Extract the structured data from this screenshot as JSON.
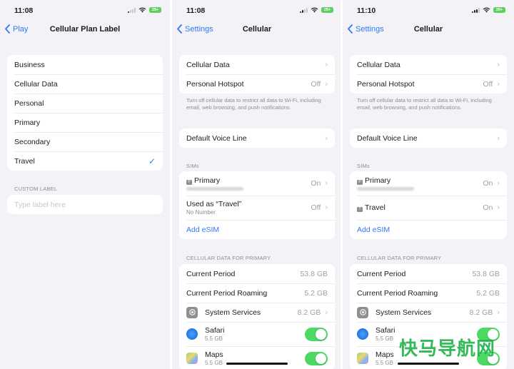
{
  "screens": [
    {
      "status": {
        "time": "11:08",
        "battery": "29+"
      },
      "nav": {
        "back": "Play",
        "title": "Cellular Plan Label"
      },
      "labels": [
        {
          "label": "Business",
          "selected": false
        },
        {
          "label": "Cellular Data",
          "selected": false
        },
        {
          "label": "Personal",
          "selected": false
        },
        {
          "label": "Primary",
          "selected": false
        },
        {
          "label": "Secondary",
          "selected": false
        },
        {
          "label": "Travel",
          "selected": true
        }
      ],
      "checkmark": "✓",
      "custom_label_header": "CUSTOM LABEL",
      "custom_label_placeholder": "Type label here"
    },
    {
      "status": {
        "time": "11:08",
        "battery": "29+"
      },
      "nav": {
        "back": "Settings",
        "title": "Cellular"
      },
      "top_group": [
        {
          "label": "Cellular Data",
          "value": ""
        },
        {
          "label": "Personal Hotspot",
          "value": "Off"
        }
      ],
      "footer": "Turn off cellular data to restrict all data to Wi-Fi, including email, web browsing, and push notifications.",
      "voice_line": "Default Voice Line",
      "sims_header": "SIMs",
      "sims": [
        {
          "badge": "P",
          "label": "Primary",
          "sub": "(redacted number)",
          "value": "On"
        },
        {
          "badge": "",
          "label": "Used as “Travel”",
          "sub": "No Number",
          "value": "Off"
        }
      ],
      "add_esim": "Add eSIM",
      "data_header": "CELLULAR DATA FOR PRIMARY",
      "data_rows": [
        {
          "label": "Current Period",
          "value": "53.8 GB"
        },
        {
          "label": "Current Period Roaming",
          "value": "5.2 GB"
        }
      ],
      "apps": [
        {
          "icon": "gear-icon",
          "label": "System Services",
          "value": "8.2 GB"
        },
        {
          "icon": "safari-icon",
          "label": "Safari",
          "sub": "5.5 GB",
          "enabled": true
        },
        {
          "icon": "maps-icon",
          "label": "Maps",
          "sub": "5.5 GB",
          "enabled": true
        }
      ]
    },
    {
      "status": {
        "time": "11:10",
        "battery": "29+"
      },
      "nav": {
        "back": "Settings",
        "title": "Cellular"
      },
      "top_group": [
        {
          "label": "Cellular Data",
          "value": ""
        },
        {
          "label": "Personal Hotspot",
          "value": "Off"
        }
      ],
      "footer": "Turn off cellular data to restrict all data to Wi-Fi, including email, web browsing, and push notifications.",
      "voice_line": "Default Voice Line",
      "sims_header": "SIMs",
      "sims": [
        {
          "badge": "P",
          "label": "Primary",
          "sub": "(redacted number)",
          "value": "On"
        },
        {
          "badge": "T",
          "label": "Travel",
          "value": "On"
        }
      ],
      "add_esim": "Add eSIM",
      "data_header": "CELLULAR DATA FOR PRIMARY",
      "data_rows": [
        {
          "label": "Current Period",
          "value": "53.8 GB"
        },
        {
          "label": "Current Period Roaming",
          "value": "5.2 GB"
        }
      ],
      "apps": [
        {
          "icon": "gear-icon",
          "label": "System Services",
          "value": "8.2 GB"
        },
        {
          "icon": "safari-icon",
          "label": "Safari",
          "sub": "5.5 GB",
          "enabled": true
        },
        {
          "icon": "maps-icon",
          "label": "Maps",
          "sub": "5.5 GB",
          "enabled": true
        }
      ]
    }
  ],
  "watermark": "快马导航网",
  "colors": {
    "accent": "#3478f6",
    "toggle_on": "#4cd964",
    "background": "#f2f2f7"
  }
}
